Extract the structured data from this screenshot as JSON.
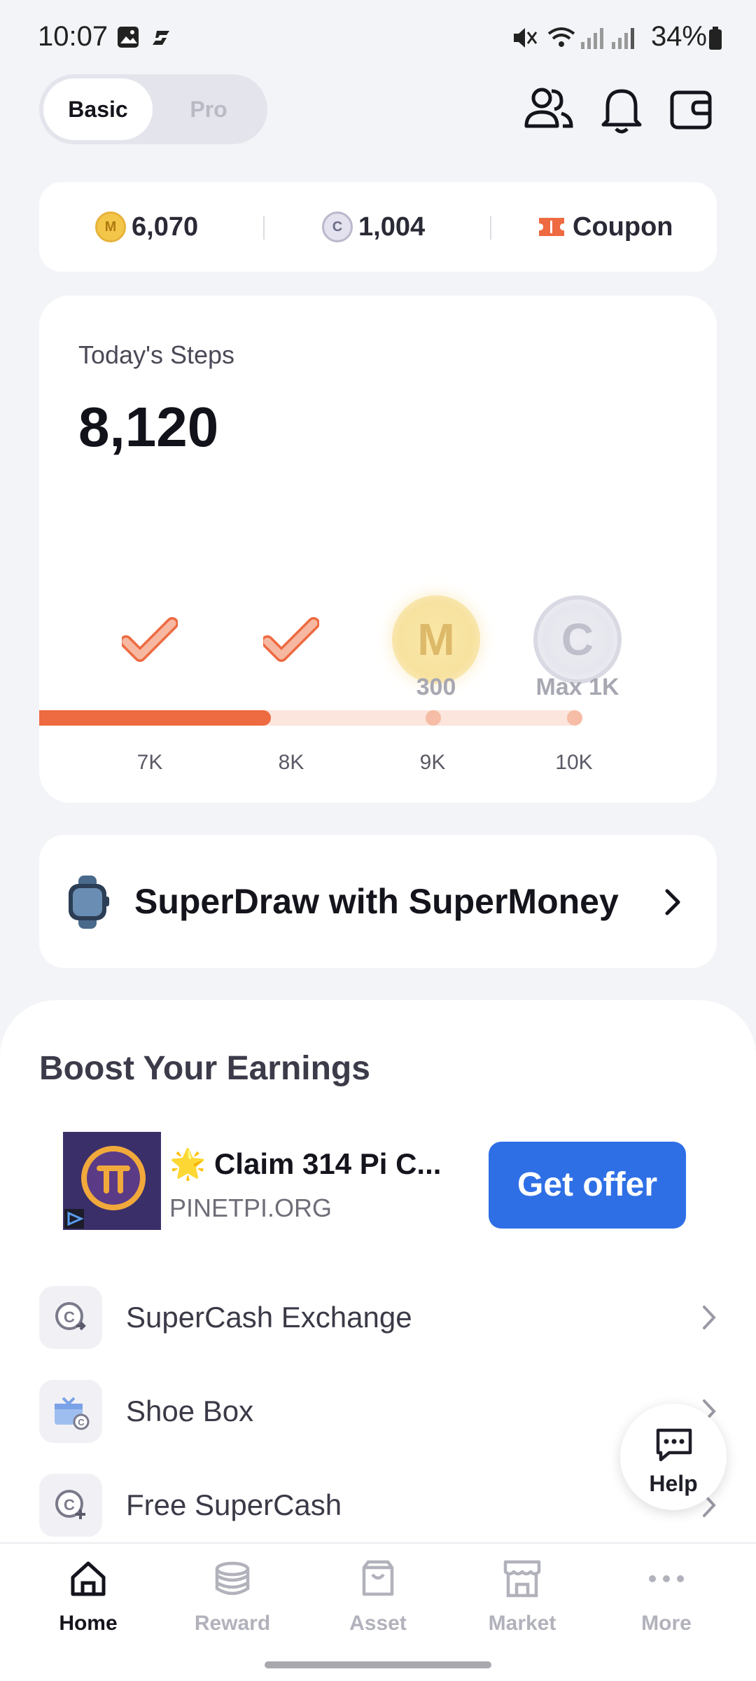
{
  "status_bar": {
    "time": "10:07",
    "battery": "34%"
  },
  "mode_toggle": {
    "basic": "Basic",
    "pro": "Pro"
  },
  "balances": {
    "supermoney": "6,070",
    "supercash": "1,004",
    "coupon": "Coupon"
  },
  "steps": {
    "label": "Today's Steps",
    "count": "8,120",
    "progress_fraction": 0.43,
    "milestones": [
      {
        "tick": "7K",
        "state": "done"
      },
      {
        "tick": "8K",
        "state": "done"
      },
      {
        "tick": "9K",
        "state": "pending",
        "reward": "300",
        "coin": "M"
      },
      {
        "tick": "10K",
        "state": "pending",
        "reward": "Max 1K",
        "coin": "C"
      }
    ]
  },
  "superdraw": {
    "label": "SuperDraw with SuperMoney"
  },
  "boost": {
    "title": "Boost Your Earnings",
    "ad": {
      "headline": "🌟 Claim 314 Pi C...",
      "domain": "PINETPI.ORG",
      "cta": "Get offer"
    },
    "items": [
      {
        "label": "SuperCash Exchange"
      },
      {
        "label": "Shoe Box"
      },
      {
        "label": "Free SuperCash"
      }
    ]
  },
  "help": {
    "label": "Help"
  },
  "tabs": [
    {
      "label": "Home",
      "active": true
    },
    {
      "label": "Reward",
      "active": false
    },
    {
      "label": "Asset",
      "active": false
    },
    {
      "label": "Market",
      "active": false
    },
    {
      "label": "More",
      "active": false
    }
  ],
  "colors": {
    "accent": "#ee6a41",
    "cta_blue": "#2f6fe6",
    "coin_gold": "#f3c64a"
  }
}
